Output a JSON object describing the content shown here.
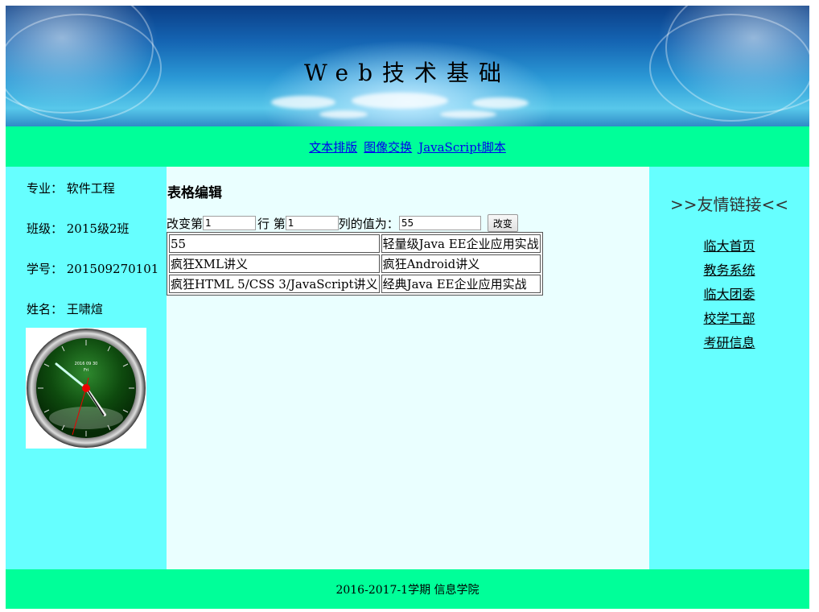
{
  "header": {
    "title": "Web技术基础"
  },
  "nav": {
    "links": [
      "文本排版",
      "图像交换",
      "JavaScript脚本"
    ]
  },
  "student": {
    "major": "专业：  软件工程",
    "class": "班级：  2015级2班",
    "id": "学号：  201509270101",
    "name": "姓名：  王啸煊"
  },
  "clock": {
    "face_text_1": "2016 09 30",
    "face_text_2": "Fri"
  },
  "main": {
    "heading": "表格编辑",
    "edit": {
      "label_prefix": "改变第",
      "row_value": "1",
      "label_row": "行 第",
      "col_value": "1",
      "label_col": "列的值为：",
      "new_value": "55",
      "button": "改变"
    },
    "table": [
      [
        "55",
        "轻量级Java EE企业应用实战"
      ],
      [
        "疯狂XML讲义",
        "疯狂Android讲义"
      ],
      [
        "疯狂HTML 5/CSS 3/JavaScript讲义",
        "经典Java EE企业应用实战"
      ]
    ]
  },
  "sidebar_right": {
    "title": ">>友情链接<<",
    "links": [
      "临大首页",
      "教务系统",
      "临大团委",
      "校学工部",
      "考研信息"
    ]
  },
  "footer": {
    "text": "2016-2017-1学期  信息学院"
  },
  "colors": {
    "nav": "#00ff99",
    "side": "#66ffff",
    "main": "#eaffff"
  }
}
